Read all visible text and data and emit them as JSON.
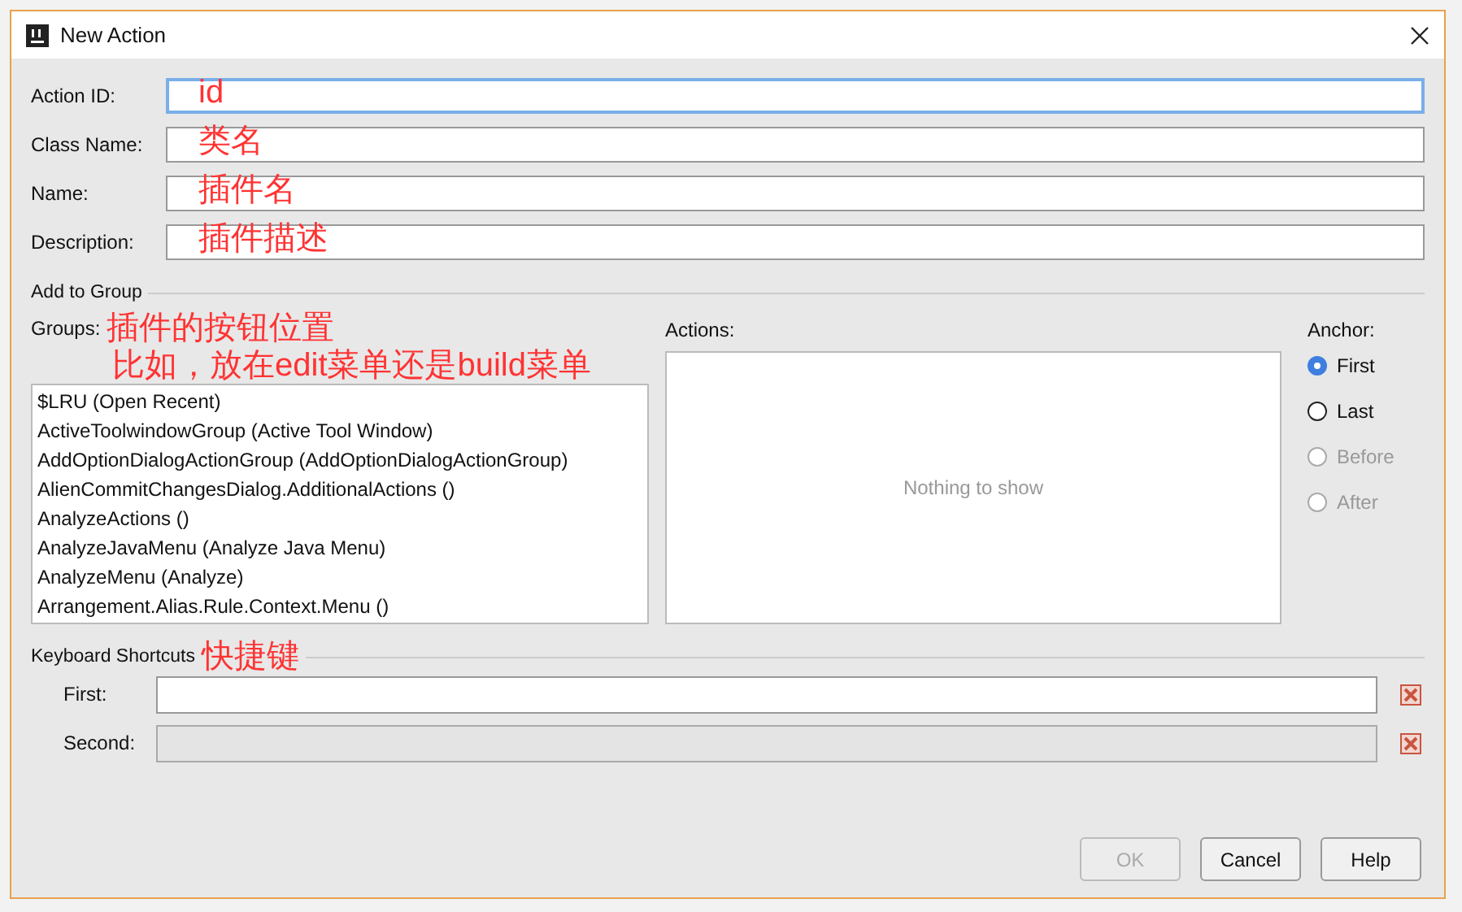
{
  "window": {
    "title": "New Action"
  },
  "fields": [
    {
      "label": "Action ID:",
      "focused": true,
      "annotation": "id"
    },
    {
      "label": "Class Name:",
      "focused": false,
      "annotation": "类名"
    },
    {
      "label": "Name:",
      "focused": false,
      "annotation": "插件名"
    },
    {
      "label": "Description:",
      "focused": false,
      "annotation": "插件描述"
    }
  ],
  "add_to_group": {
    "title": "Add to Group",
    "groups": {
      "label": "Groups:",
      "annotation": "插件的按钮位置",
      "annotation_2": "比如，放在edit菜单还是build菜单",
      "items": [
        {
          "text": "$LRU (Open Recent)",
          "selected": false
        },
        {
          "text": "ActiveToolwindowGroup (Active Tool Window)",
          "selected": false
        },
        {
          "text": "AddOptionDialogActionGroup (AddOptionDialogActionGroup)",
          "selected": false
        },
        {
          "text": "AlienCommitChangesDialog.AdditionalActions ()",
          "selected": false
        },
        {
          "text": "AnalyzeActions ()",
          "selected": false
        },
        {
          "text": "AnalyzeJavaMenu (Analyze Java Menu)",
          "selected": false
        },
        {
          "text": "AnalyzeMenu (Analyze)",
          "selected": false
        },
        {
          "text": "Arrangement.Alias.Rule.Context.Menu ()",
          "selected": false
        }
      ]
    },
    "actions": {
      "label": "Actions:",
      "empty_text": "Nothing to show"
    },
    "anchor": {
      "label": "Anchor:",
      "options": [
        {
          "label": "First",
          "selected": true,
          "disabled": false
        },
        {
          "label": "Last",
          "selected": false,
          "disabled": false
        },
        {
          "label": "Before",
          "selected": false,
          "disabled": true
        },
        {
          "label": "After",
          "selected": false,
          "disabled": true
        }
      ]
    }
  },
  "keyboard_shortcuts": {
    "title": "Keyboard Shortcuts",
    "annotation": "快捷键",
    "fields": [
      {
        "label": "First:",
        "disabled": false
      },
      {
        "label": "Second:",
        "disabled": true
      }
    ]
  },
  "buttons": [
    {
      "label": "OK",
      "disabled": true
    },
    {
      "label": "Cancel",
      "disabled": false
    },
    {
      "label": "Help",
      "disabled": false
    }
  ]
}
